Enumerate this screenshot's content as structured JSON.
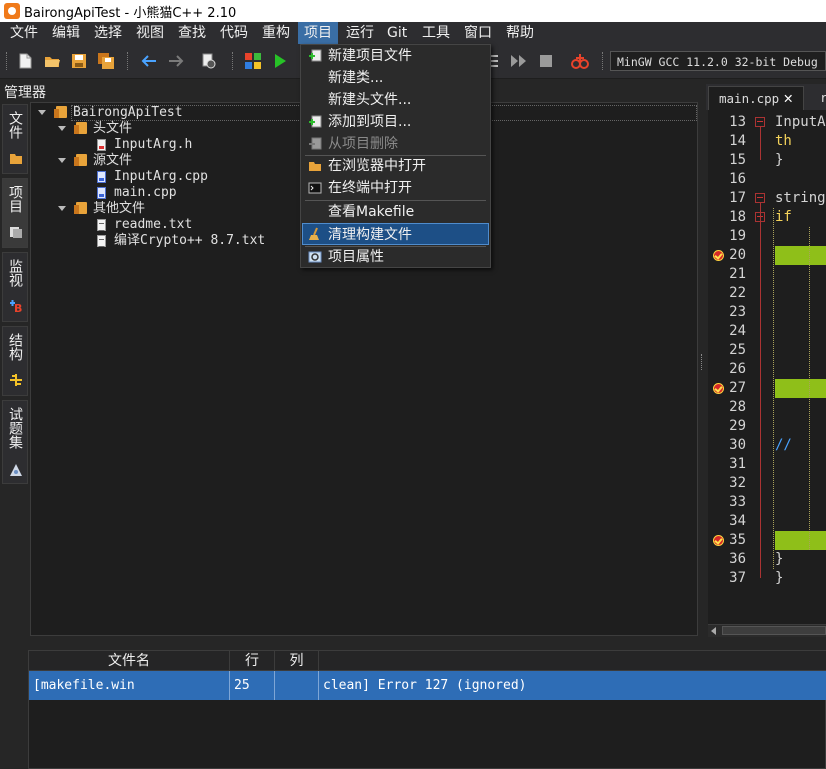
{
  "window": {
    "title": "BairongApiTest - 小熊猫C++ 2.10"
  },
  "menubar": {
    "items": [
      "文件",
      "编辑",
      "选择",
      "视图",
      "查找",
      "代码",
      "重构",
      "项目",
      "运行",
      "Git",
      "工具",
      "窗口",
      "帮助"
    ],
    "active": "项目"
  },
  "toolbar": {
    "compiler": "MinGW GCC 11.2.0 32-bit Debug"
  },
  "project_menu": {
    "items": [
      {
        "label": "新建项目文件",
        "icon": "new-project-file-icon",
        "enabled": true
      },
      {
        "label": "新建类...",
        "icon": "",
        "enabled": true
      },
      {
        "label": "新建头文件...",
        "icon": "",
        "enabled": true
      },
      {
        "label": "添加到项目...",
        "icon": "add-to-project-icon",
        "enabled": true
      },
      {
        "label": "从项目删除",
        "icon": "remove-from-project-icon",
        "enabled": false
      },
      {
        "label": "在浏览器中打开",
        "icon": "folder-icon",
        "enabled": true
      },
      {
        "label": "在终端中打开",
        "icon": "terminal-icon",
        "enabled": true
      },
      {
        "label": "查看Makefile",
        "icon": "",
        "enabled": true
      },
      {
        "label": "清理构建文件",
        "icon": "broom-icon",
        "enabled": true,
        "highlighted": true
      },
      {
        "label": "项目属性",
        "icon": "project-settings-icon",
        "enabled": true
      }
    ]
  },
  "manager": {
    "title": "管理器",
    "side_tabs": [
      "文件",
      "项目",
      "监视",
      "结构",
      "试题集"
    ],
    "active_tab": "项目",
    "tree": {
      "root": "BairongApiTest",
      "folders": [
        {
          "name": "头文件",
          "files": [
            "InputArg.h"
          ]
        },
        {
          "name": "源文件",
          "files": [
            "InputArg.cpp",
            "main.cpp"
          ]
        },
        {
          "name": "其他文件",
          "files": [
            "readme.txt",
            "编译Crypto++ 8.7.txt"
          ]
        }
      ]
    }
  },
  "editor": {
    "tabs": [
      {
        "label": "main.cpp",
        "active": true
      },
      {
        "label": "r",
        "active": false
      }
    ],
    "lines": [
      "13",
      "14",
      "15",
      "16",
      "17",
      "18",
      "19",
      "20",
      "21",
      "22",
      "23",
      "24",
      "25",
      "26",
      "27",
      "28",
      "29",
      "30",
      "31",
      "32",
      "33",
      "34",
      "35",
      "36",
      "37"
    ],
    "breakpoint_lines": [
      "20",
      "27",
      "35"
    ],
    "code": {
      "13": "InputA",
      "14": "    th",
      "15": "}",
      "17": "string",
      "18": "    if",
      "30": "//",
      "36": "    }",
      "37": "}"
    }
  },
  "messages": {
    "columns": [
      "文件名",
      "行",
      "列",
      ""
    ],
    "rows": [
      {
        "file": "[makefile.win",
        "line": "25",
        "col": "",
        "message": "clean] Error 127 (ignored)"
      }
    ]
  },
  "colors": {
    "accent": "#3a6ea5",
    "selection": "#2e6db6",
    "breakpoint_highlight": "#8fbf19"
  }
}
